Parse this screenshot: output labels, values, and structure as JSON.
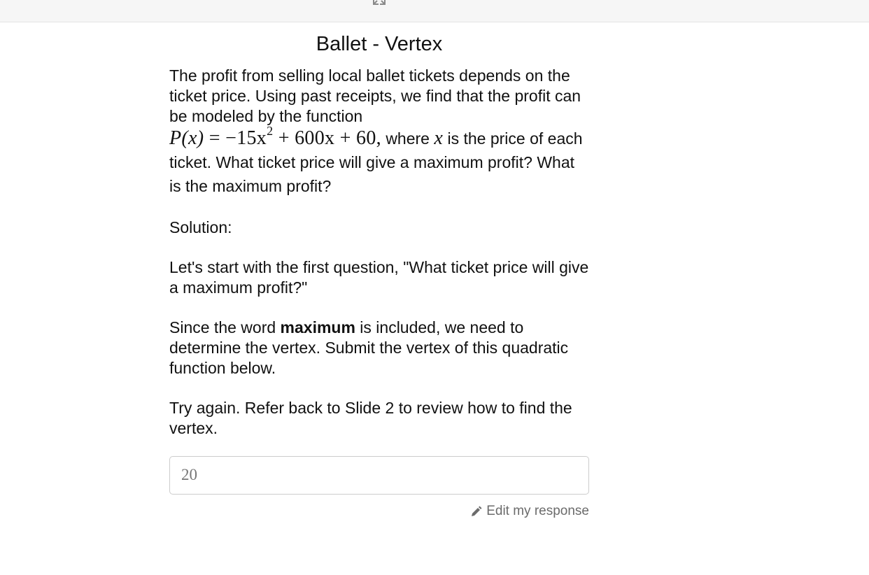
{
  "toolbar": {
    "icon": "expand-icon"
  },
  "page": {
    "title": "Ballet - Vertex"
  },
  "problem": {
    "intro": "The profit from selling local ballet tickets depends on the ticket price. Using past receipts, we find that the profit can be modeled by the function",
    "formula": {
      "lhs": "P(x)",
      "equals": "=",
      "term1": "−15x",
      "exponent": "2",
      "rest": "+ 600x + 60,"
    },
    "after_formula_1": "where",
    "variable": "x",
    "after_formula_2": "is the price of each ticket. What ticket price will give a maximum profit? What is the maximum profit?",
    "solution_label": "Solution:",
    "first_question": "Let's start with the first question, \"What ticket price will give a maximum profit?\"",
    "since_pre": "Since the word",
    "since_bold": "maximum",
    "since_post": "is included, we need to determine the vertex. Submit the vertex of this quadratic function below.",
    "feedback": "Try again. Refer back to Slide 2 to review how to find the vertex."
  },
  "answer": {
    "value": "20"
  },
  "edit": {
    "label": "Edit my response",
    "icon": "pencil-icon"
  }
}
